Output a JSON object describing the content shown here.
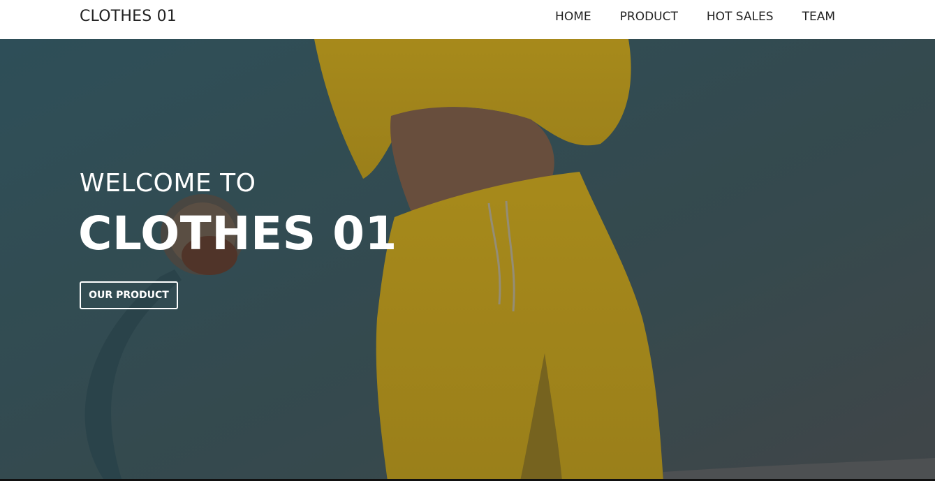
{
  "navbar": {
    "brand": "CLOTHES 01",
    "links": [
      "HOME",
      "PRODUCT",
      "HOT SALES",
      "TEAM"
    ]
  },
  "hero": {
    "subtitle": "WELCOME TO",
    "title": "CLOTHES 01",
    "cta_label": "OUR PRODUCT"
  },
  "colors": {
    "navbar_bg": "#ffffff",
    "hero_text": "#ffffff",
    "outfit_yellow": "#c9a31a",
    "sky": "#2d4a56"
  }
}
